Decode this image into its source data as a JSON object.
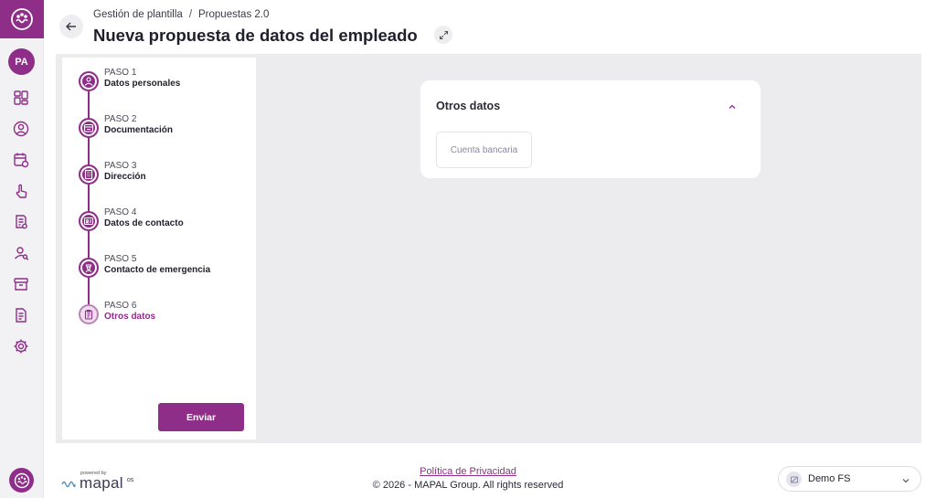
{
  "sidebar": {
    "avatar_initials": "PA",
    "items": [
      {
        "icon": "dashboard-icon"
      },
      {
        "icon": "user-circle-icon"
      },
      {
        "icon": "calendar-clock-icon"
      },
      {
        "icon": "hand-pointer-icon"
      },
      {
        "icon": "document-settings-icon"
      },
      {
        "icon": "user-search-icon"
      },
      {
        "icon": "archive-icon"
      },
      {
        "icon": "report-icon"
      },
      {
        "icon": "gear-icon"
      }
    ]
  },
  "header": {
    "breadcrumb": [
      "Gestión de plantilla",
      "Propuestas 2.0"
    ],
    "breadcrumb_separator": "/",
    "title": "Nueva propuesta de datos del empleado"
  },
  "steps": [
    {
      "label": "PASO 1",
      "name": "Datos personales",
      "icon": "user-icon",
      "status": "done"
    },
    {
      "label": "PASO 2",
      "name": "Documentación",
      "icon": "id-card-icon",
      "status": "done"
    },
    {
      "label": "PASO 3",
      "name": "Dirección",
      "icon": "building-icon",
      "status": "done"
    },
    {
      "label": "PASO 4",
      "name": "Datos de contacto",
      "icon": "contact-card-icon",
      "status": "done"
    },
    {
      "label": "PASO 5",
      "name": "Contacto de emergencia",
      "icon": "medic-icon",
      "status": "done"
    },
    {
      "label": "PASO 6",
      "name": "Otros datos",
      "icon": "clipboard-icon",
      "status": "current"
    }
  ],
  "submit_label": "Enviar",
  "card": {
    "title": "Otros datos",
    "option": "Cuenta bancaria"
  },
  "footer": {
    "powered_by": "powered by",
    "brand": "mapal",
    "brand_suffix": "os",
    "privacy": "Política de Privacidad",
    "copyright": "© 2026 - MAPAL Group. All rights reserved",
    "company": "Demo FS"
  },
  "colors": {
    "brand": "#8e2e88",
    "panel_bg": "#ececee"
  }
}
